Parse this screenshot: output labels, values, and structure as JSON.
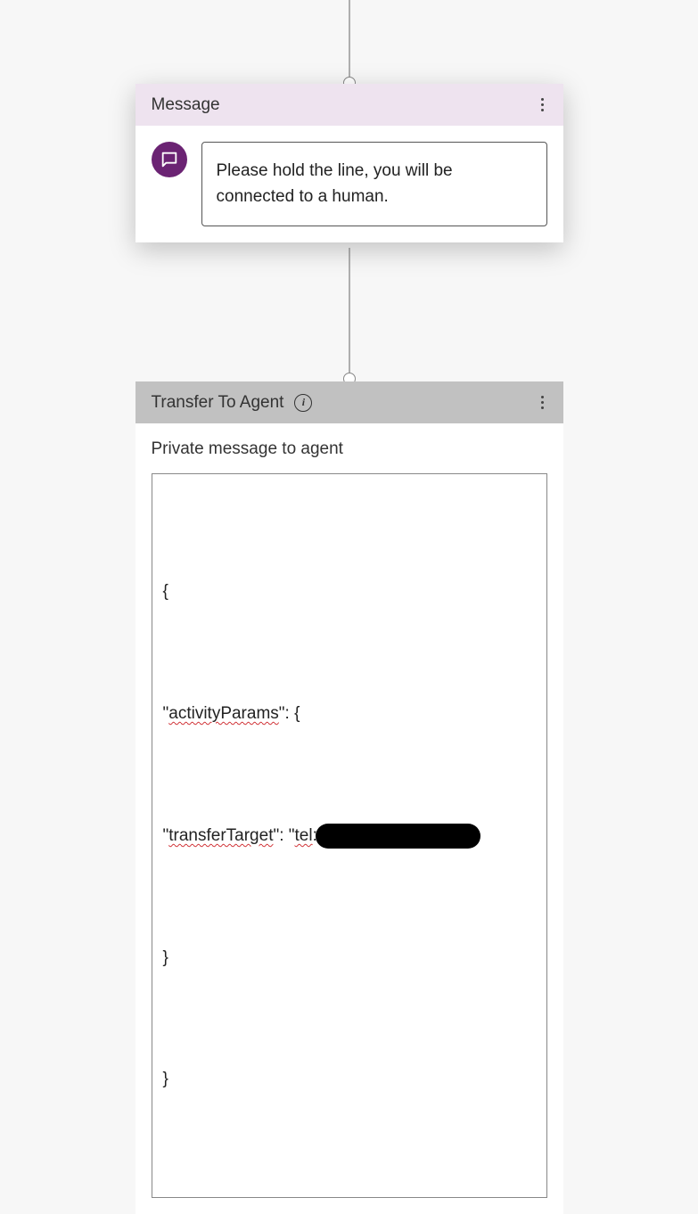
{
  "nodes": {
    "message": {
      "title": "Message",
      "body": "Please hold the line, you will be connected to a human."
    },
    "transfer": {
      "title": "Transfer To Agent",
      "field_label": "Private message to agent",
      "code": {
        "line1": "{",
        "line2_prefix": "\"",
        "line2_key": "activityParams",
        "line2_suffix": "\": {",
        "line3_prefix": "\"",
        "line3_key1": "transferTarget",
        "line3_mid": "\": \"",
        "line3_key2": "tel",
        "line3_suffix": ":",
        "line4": "}",
        "line5": "}"
      }
    }
  },
  "icons": {
    "info_glyph": "i"
  }
}
